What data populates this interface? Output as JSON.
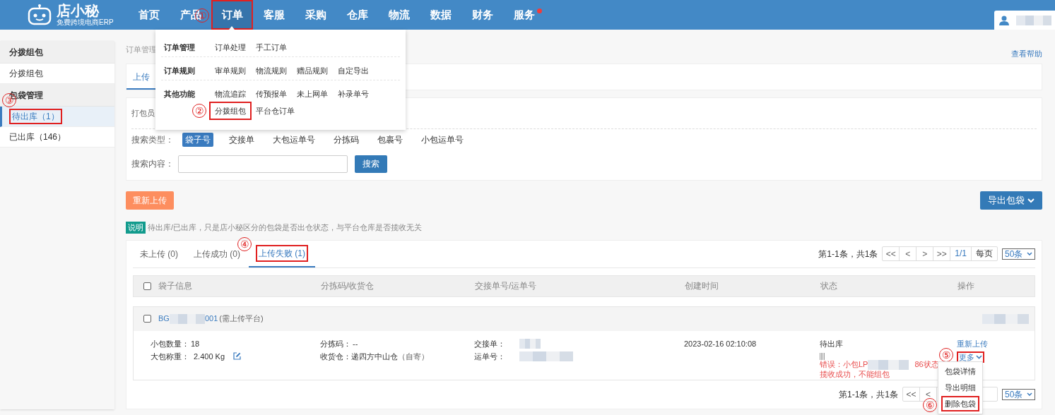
{
  "logo": {
    "name": "店小秘",
    "tagline": "免费跨境电商ERP"
  },
  "nav": [
    {
      "label": "首页",
      "selected": false,
      "dot": false
    },
    {
      "label": "产品",
      "selected": false,
      "dot": false
    },
    {
      "label": "订单",
      "selected": true,
      "dot": false,
      "annotation": "①"
    },
    {
      "label": "客服",
      "selected": false,
      "dot": false
    },
    {
      "label": "采购",
      "selected": false,
      "dot": false
    },
    {
      "label": "仓库",
      "selected": false,
      "dot": false
    },
    {
      "label": "物流",
      "selected": false,
      "dot": false
    },
    {
      "label": "数据",
      "selected": false,
      "dot": false
    },
    {
      "label": "财务",
      "selected": false,
      "dot": false
    },
    {
      "label": "服务",
      "selected": false,
      "dot": true
    }
  ],
  "nav_menu": {
    "groups": [
      {
        "title": "订单管理",
        "rows": [
          [
            {
              "label": "订单处理"
            },
            {
              "label": "手工订单"
            }
          ]
        ]
      },
      {
        "title": "订单规则",
        "rows": [
          [
            {
              "label": "审单规则"
            },
            {
              "label": "物流规则"
            },
            {
              "label": "赠品规则"
            },
            {
              "label": "自定导出"
            }
          ]
        ]
      },
      {
        "title": "其他功能",
        "rows": [
          [
            {
              "label": "物流追踪"
            },
            {
              "label": "传预报单"
            },
            {
              "label": "未上网单"
            },
            {
              "label": "补录单号"
            }
          ],
          [
            {
              "label": "分拨组包",
              "annotation": "②"
            },
            {
              "label": "平台仓订单"
            }
          ]
        ]
      }
    ]
  },
  "sidebar": [
    {
      "title": "分拨组包",
      "items": [
        {
          "label": "分拨组包",
          "selected": false
        }
      ]
    },
    {
      "title": "包袋管理",
      "items": [
        {
          "label": "待出库（1）",
          "selected": true,
          "annotation": "③"
        },
        {
          "label": "已出库（146）",
          "selected": false
        }
      ]
    }
  ],
  "breadcrumb": "订单管理",
  "help_link": "查看帮助",
  "top_tab": "上传",
  "filter": {
    "packer_label": "打包员",
    "search_type_label": "搜索类型：",
    "search_types": [
      {
        "label": "袋子号",
        "selected": true
      },
      {
        "label": "交接单",
        "selected": false
      },
      {
        "label": "大包运单号",
        "selected": false
      },
      {
        "label": "分拣码",
        "selected": false
      },
      {
        "label": "包裹号",
        "selected": false
      },
      {
        "label": "小包运单号",
        "selected": false
      }
    ],
    "search_content_label": "搜索内容：",
    "search_button": "搜索"
  },
  "reupload_button": "重新上传",
  "export_button": "导出包袋",
  "note": {
    "tag": "说明",
    "text": "待出库/已出库，只是店小秘区分的包袋是否出仓状态，与平台仓库是否揽收无关"
  },
  "status_tabs": [
    {
      "label": "未上传 (0)",
      "selected": false
    },
    {
      "label": "上传成功 (0)",
      "selected": false
    },
    {
      "label": "上传失败 (1)",
      "selected": true,
      "annotation": "④"
    }
  ],
  "pagination": {
    "summary": "第1-1条，共1条",
    "buttons": [
      "<<",
      "<",
      ">",
      ">>"
    ],
    "page": "1/1",
    "per_page_label": "每页",
    "per_page": "50条"
  },
  "select_all_checked": false,
  "columns": [
    "袋子信息",
    "分拣码/收货仓",
    "交接单号/运单号",
    "创建时间",
    "状态",
    "操作"
  ],
  "bags": [
    {
      "checked": false,
      "id_prefix": "BG",
      "id_suffix": "001",
      "id_note": "(需上传平台)",
      "qty_label": "小包数量：",
      "qty": "18",
      "weight_label": "大包称重：",
      "weight": "2.400 Kg",
      "sort_code_label": "分拣码：",
      "sort_code": "--",
      "warehouse_label": "收货仓：",
      "warehouse": "递四方中山仓",
      "warehouse_note": "（自寄）",
      "handover_label": "交接单：",
      "waybill_label": "运单号：",
      "created": "2023-02-16 02:10:08",
      "status": "待出库",
      "error_start": "错误：小包LP",
      "error_mid": "86状态",
      "error_end": "揽收成功，不能组包",
      "action": "重新上传",
      "more": "更多",
      "more_annotation": "⑤",
      "more_menu": [
        {
          "label": "包袋详情"
        },
        {
          "label": "导出明细"
        },
        {
          "label": "删除包袋",
          "annotation": "⑥"
        }
      ]
    }
  ],
  "bottom_pagination": {
    "summary": "第1-1条，共1条",
    "buttons": [
      "<<",
      "<"
    ],
    "per_page": "50条"
  }
}
